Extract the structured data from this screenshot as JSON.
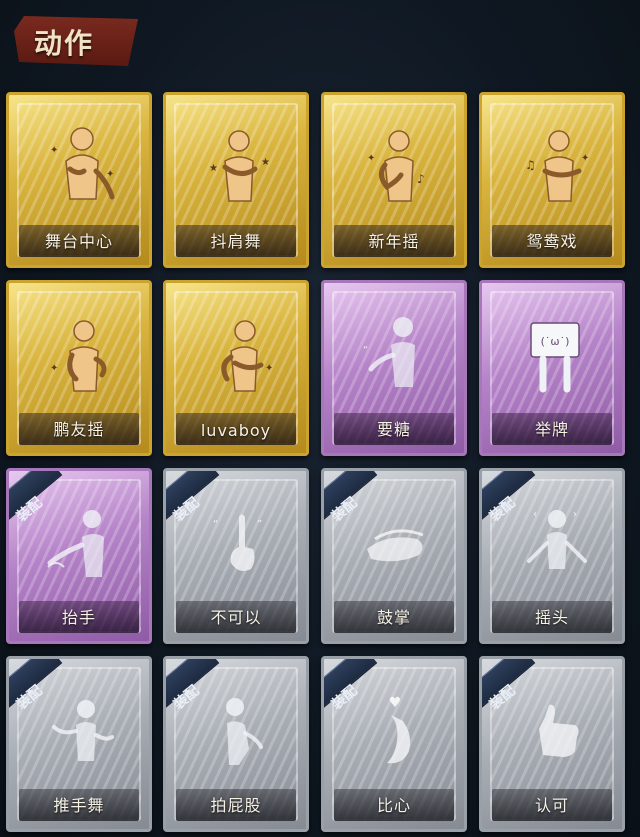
{
  "header": {
    "title": "动作"
  },
  "cards": [
    {
      "label": "舞台中心",
      "style": "gold",
      "equipped": false,
      "icon": "pose-stage-center-icon"
    },
    {
      "label": "抖肩舞",
      "style": "gold",
      "equipped": false,
      "icon": "pose-shoulder-shake-icon"
    },
    {
      "label": "新年摇",
      "style": "gold",
      "equipped": false,
      "icon": "pose-new-year-shake-icon"
    },
    {
      "label": "鸳鸯戏",
      "style": "gold",
      "equipped": false,
      "icon": "pose-mandarin-duck-icon"
    },
    {
      "label": "鹏友摇",
      "style": "gold",
      "equipped": false,
      "icon": "pose-friend-shake-icon"
    },
    {
      "label": "luvaboy",
      "style": "gold",
      "equipped": false,
      "icon": "pose-luvaboy-icon"
    },
    {
      "label": "要糖",
      "style": "purple",
      "equipped": false,
      "icon": "pose-ask-candy-icon"
    },
    {
      "label": "举牌",
      "style": "purple",
      "equipped": false,
      "icon": "pose-hold-sign-icon"
    },
    {
      "label": "抬手",
      "style": "purple",
      "equipped": true,
      "icon": "pose-raise-hand-icon"
    },
    {
      "label": "不可以",
      "style": "gray",
      "equipped": true,
      "icon": "pose-no-icon"
    },
    {
      "label": "鼓掌",
      "style": "gray",
      "equipped": true,
      "icon": "pose-clap-icon"
    },
    {
      "label": "摇头",
      "style": "gray",
      "equipped": true,
      "icon": "pose-shake-head-icon"
    },
    {
      "label": "推手舞",
      "style": "gray",
      "equipped": true,
      "icon": "pose-push-hand-dance-icon"
    },
    {
      "label": "拍屁股",
      "style": "gray",
      "equipped": true,
      "icon": "pose-pat-butt-icon"
    },
    {
      "label": "比心",
      "style": "gray",
      "equipped": true,
      "icon": "pose-heart-hand-icon"
    },
    {
      "label": "认可",
      "style": "gray",
      "equipped": true,
      "icon": "pose-thumbs-up-icon"
    }
  ],
  "badge_text": "装配",
  "colors": {
    "gold": "#d9b43e",
    "purple": "#b583c8",
    "gray": "#a9aeb5",
    "title_banner": "#7a2a1e",
    "badge": "#2e3f5c"
  }
}
